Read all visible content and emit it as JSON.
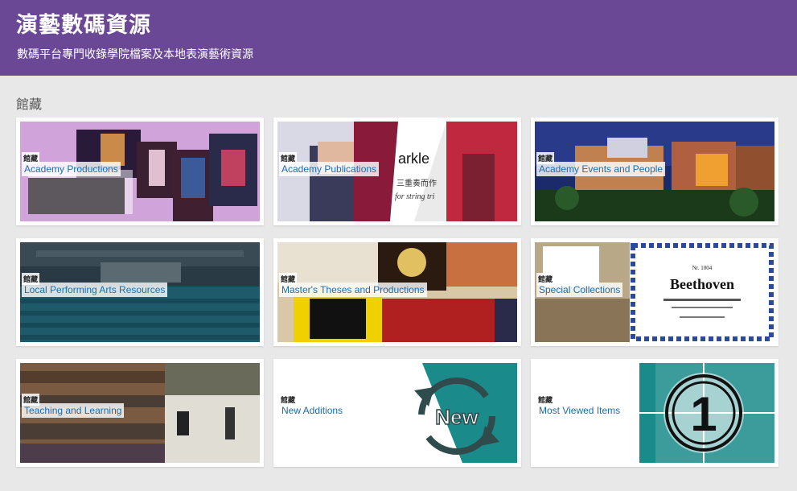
{
  "header": {
    "title": "演藝數碼資源",
    "subtitle": "數碼平台專門收錄學院檔案及本地表演藝術資源"
  },
  "section_label": "館藏",
  "collections": [
    {
      "tag": "館藏",
      "label": "Academy Productions"
    },
    {
      "tag": "館藏",
      "label": "Academy Publications"
    },
    {
      "tag": "館藏",
      "label": "Academy Events and People"
    },
    {
      "tag": "館藏",
      "label": "Local Performing Arts Resources"
    },
    {
      "tag": "館藏",
      "label": "Master's Theses and Productions"
    },
    {
      "tag": "館藏",
      "label": "Special Collections"
    },
    {
      "tag": "館藏",
      "label": "Teaching and Learning"
    },
    {
      "tag": "館藏",
      "label": "New Additions"
    },
    {
      "tag": "館藏",
      "label": "Most Viewed Items"
    }
  ],
  "image_text": {
    "publications_word": "arkle",
    "publications_cn": "三重奏而作",
    "publications_sub": "for string tri",
    "new_badge": "New",
    "most_viewed_number": "1",
    "beethoven_title": "Beethoven",
    "beethoven_no": "Nr. 1004"
  },
  "colors": {
    "header_bg": "#6a4895",
    "label_text": "#1c6cab",
    "teal": "#1a8a8a"
  }
}
